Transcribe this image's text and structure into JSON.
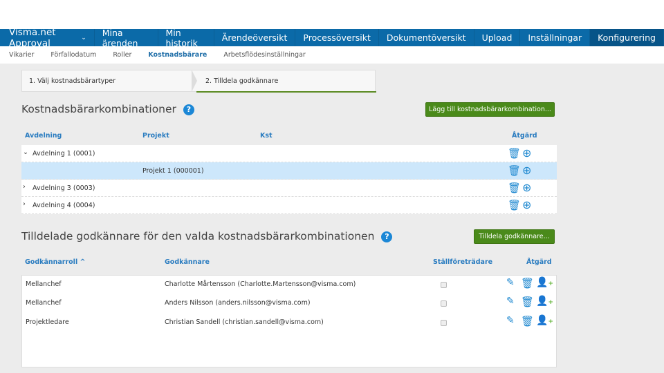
{
  "nav": {
    "brand": "Visma.net Approval",
    "items": [
      "Mina ärenden",
      "Min historik",
      "Ärendeöversikt",
      "Processöversikt",
      "Dokumentöversikt",
      "Upload",
      "Inställningar",
      "Konfigurering"
    ],
    "active": "Konfigurering"
  },
  "subnav": {
    "items": [
      "Vikarier",
      "Förfallodatum",
      "Roller",
      "Kostnadsbärare",
      "Arbetsflödesinställningar"
    ],
    "active": "Kostnadsbärare"
  },
  "steps": [
    "1. Välj kostnadsbärartyper",
    "2. Tilldela godkännare"
  ],
  "combos": {
    "title": "Kostnadsbärarkombinationer",
    "add_button": "Lägg till kostnadsbärarkombination...",
    "headers": [
      "Avdelning",
      "Projekt",
      "Kst",
      "Åtgärd"
    ],
    "rows": [
      {
        "avdelning": "Avdelning 1 (0001)",
        "projekt": "",
        "expanded": true
      },
      {
        "avdelning": "",
        "projekt": "Projekt 1 (000001)",
        "selected": true
      },
      {
        "avdelning": "Avdelning 3 (0003)",
        "projekt": ""
      },
      {
        "avdelning": "Avdelning 4 (0004)",
        "projekt": ""
      }
    ]
  },
  "approvers": {
    "title": "Tilldelade godkännare för den valda kostnadsbärarkombinationen",
    "assign_button": "Tilldela godkännare...",
    "headers": [
      "Godkännarroll",
      "Godkännare",
      "Ställföreträdare",
      "Åtgärd"
    ],
    "rows": [
      {
        "role": "Mellanchef",
        "approver": "Charlotte Mårtensson (Charlotte.Martensson@visma.com)",
        "deputy": false
      },
      {
        "role": "Mellanchef",
        "approver": "Anders Nilsson (anders.nilsson@visma.com)",
        "deputy": false
      },
      {
        "role": "Projektledare",
        "approver": "Christian Sandell (christian.sandell@visma.com)",
        "deputy": false
      }
    ]
  },
  "help_glyph": "?"
}
